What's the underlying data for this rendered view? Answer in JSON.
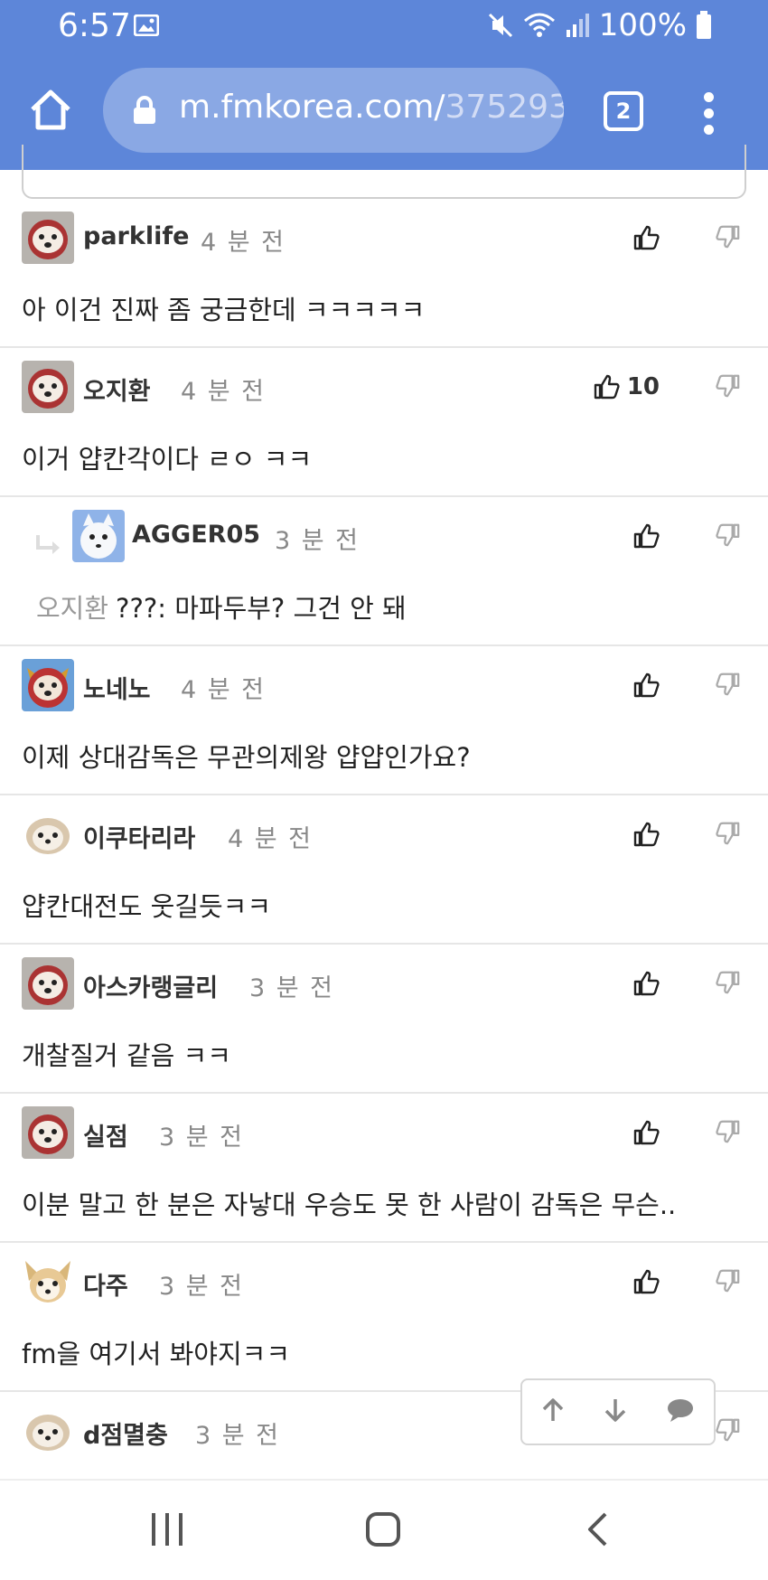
{
  "status_bar": {
    "time": "6:57",
    "battery": "100%"
  },
  "browser": {
    "url_host": "m.fmkorea.com/",
    "url_path": "375293",
    "tab_count": "2"
  },
  "comments": [
    {
      "nick": "parklife",
      "time": "4 분 전",
      "content": "아 이건 진짜 좀 궁금한데 ㅋㅋㅋㅋㅋ",
      "likes": ""
    },
    {
      "nick": "오지환",
      "time": "4 분 전",
      "content": "이거 얍칸각이다 ㄹㅇ ㅋㅋ",
      "likes": "10"
    },
    {
      "nick": "AGGER05",
      "time": "3 분 전",
      "mention": "오지환",
      "content": "???: 마파두부? 그건 안 돼",
      "likes": ""
    },
    {
      "nick": "노네노",
      "time": "4 분 전",
      "content": "이제 상대감독은 무관의제왕 얍얍인가요?",
      "likes": ""
    },
    {
      "nick": "이쿠타리라",
      "time": "4 분 전",
      "content": "얍칸대전도 웃길듯ㅋㅋ",
      "likes": ""
    },
    {
      "nick": "아스카랭글리",
      "time": "3 분 전",
      "content": "개찰질거 같음 ㅋㅋ",
      "likes": ""
    },
    {
      "nick": "실점",
      "time": "3 분 전",
      "content": "이분 말고 한 분은 자낳대 우승도 못 한 사람이 감독은 무슨..",
      "likes": ""
    },
    {
      "nick": "다주",
      "time": "3 분 전",
      "content": "fm을 여기서 봐야지ㅋㅋ",
      "likes": ""
    },
    {
      "nick": "d점멸충",
      "time": "3 분 전",
      "content": "",
      "likes": ""
    }
  ]
}
